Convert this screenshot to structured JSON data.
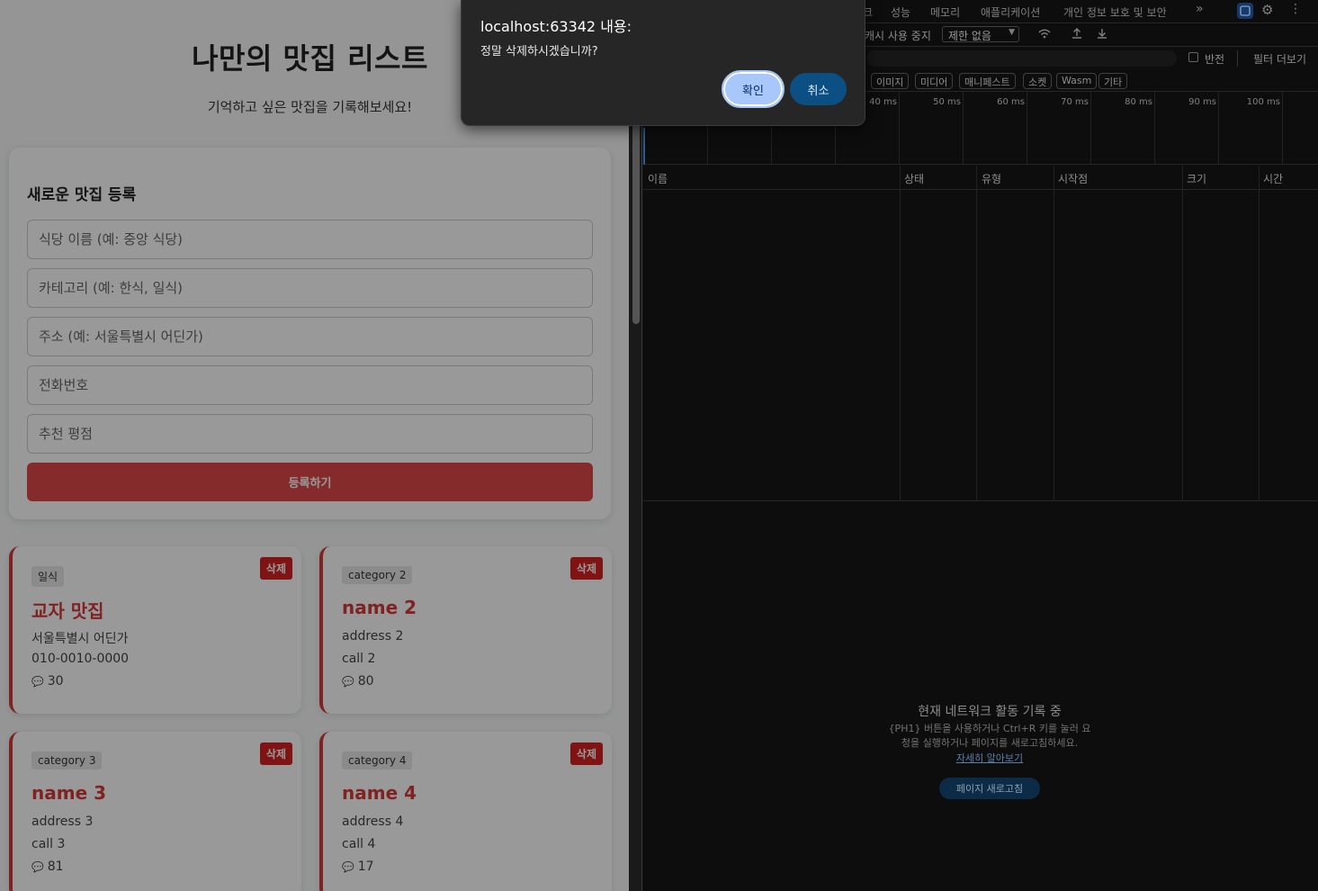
{
  "page": {
    "title": "나만의 맛집 리스트",
    "subtitle": "기억하고 싶은 맛집을 기록해보세요!",
    "form": {
      "heading": "새로운 맛집 등록",
      "name_placeholder": "식당 이름 (예: 중앙 식당)",
      "category_placeholder": "카테고리 (예: 한식, 일식)",
      "address_placeholder": "주소 (예: 서울특별시 어딘가)",
      "phone_placeholder": "전화번호",
      "rating_placeholder": "추천 평점",
      "submit_label": "등록하기"
    },
    "delete_label": "삭제",
    "cards": [
      {
        "category": "일식",
        "name": "교자 맛집",
        "address": "서울특별시 어딘가",
        "call": "010-0010-0000",
        "score": "30"
      },
      {
        "category": "category 2",
        "name": "name 2",
        "address": "address 2",
        "call": "call 2",
        "score": "80"
      },
      {
        "category": "category 3",
        "name": "name 3",
        "address": "address 3",
        "call": "call 3",
        "score": "81"
      },
      {
        "category": "category 4",
        "name": "name 4",
        "address": "address 4",
        "call": "call 4",
        "score": "17"
      }
    ]
  },
  "devtools": {
    "tabs": [
      "크",
      "성능",
      "메모리",
      "애플리케이션",
      "개인 정보 보호 및 보안",
      "»"
    ],
    "toolbar": {
      "disable_cache": "캐시 사용 중지",
      "throttle": "제한 없음"
    },
    "filter": {
      "invert": "반전",
      "more_filters": "필터 더보기"
    },
    "types": [
      "이미지",
      "미디어",
      "매니페스트",
      "소켓",
      "Wasm",
      "기타"
    ],
    "ticks": [
      "40 ms",
      "50 ms",
      "60 ms",
      "70 ms",
      "80 ms",
      "90 ms",
      "100 ms"
    ],
    "columns": [
      "이름",
      "상태",
      "유형",
      "시작점",
      "크기",
      "시간"
    ],
    "empty": {
      "title": "현재 네트워크 활동 기록 중",
      "desc_line1": "{PH1} 버튼을 사용하거나 Ctrl+R 키를 눌러 요",
      "desc_line2": "청을 실행하거나 페이지를 새로고침하세요.",
      "link": "자세히 알아보기",
      "reload": "페이지 새로고침"
    }
  },
  "dialog": {
    "title": "localhost:63342 내용:",
    "message": "정말 삭제하시겠습니까?",
    "ok": "확인",
    "cancel": "취소"
  },
  "colors": {
    "accent": "#d63a3a",
    "dialog_ok": "#a8c7fa",
    "dialog_cancel": "#0b4f83"
  }
}
